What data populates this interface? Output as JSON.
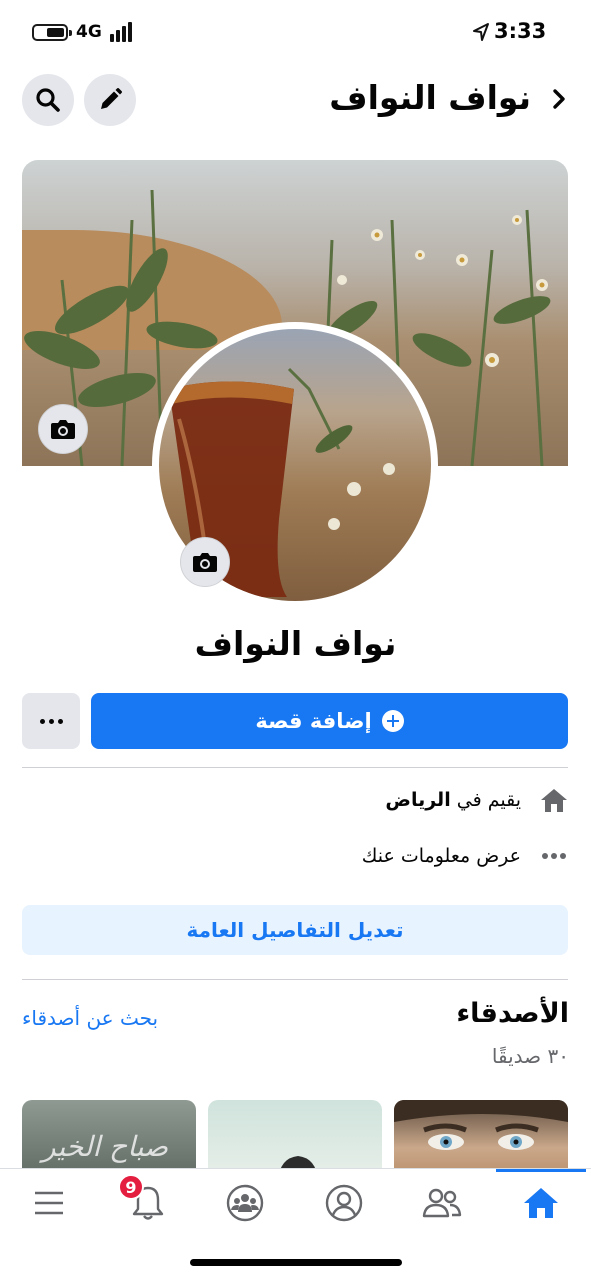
{
  "status_bar": {
    "network": "4G",
    "time": "3:33"
  },
  "header": {
    "title": "نواف النواف",
    "icons": {
      "back": "chevron-right-icon",
      "edit": "pencil-icon",
      "search": "search-icon"
    }
  },
  "profile": {
    "name": "نواف النواف"
  },
  "actions": {
    "add_story": "إضافة قصة",
    "more": "more-icon"
  },
  "intro": {
    "lives_in_prefix": "يقيم في",
    "lives_in_city": "الرياض",
    "see_about": "عرض معلومات عنك",
    "edit_details": "تعديل التفاصيل العامة"
  },
  "friends": {
    "title": "الأصدقاء",
    "count": "٣٠ صديقًا",
    "find": "بحث عن أصدقاء",
    "thumb_script": "صباح الخير"
  },
  "bottom_nav": {
    "notifications_badge": "9",
    "items": [
      "menu-icon",
      "bell-icon",
      "groups-icon",
      "profile-icon",
      "friends-icon",
      "home-icon"
    ],
    "active": "home-icon"
  },
  "colors": {
    "accent": "#1877f2",
    "light_accent": "#e7f3ff",
    "badge": "#e41e3f",
    "secondary_text": "#65676b",
    "button_gray": "#e4e6eb"
  }
}
